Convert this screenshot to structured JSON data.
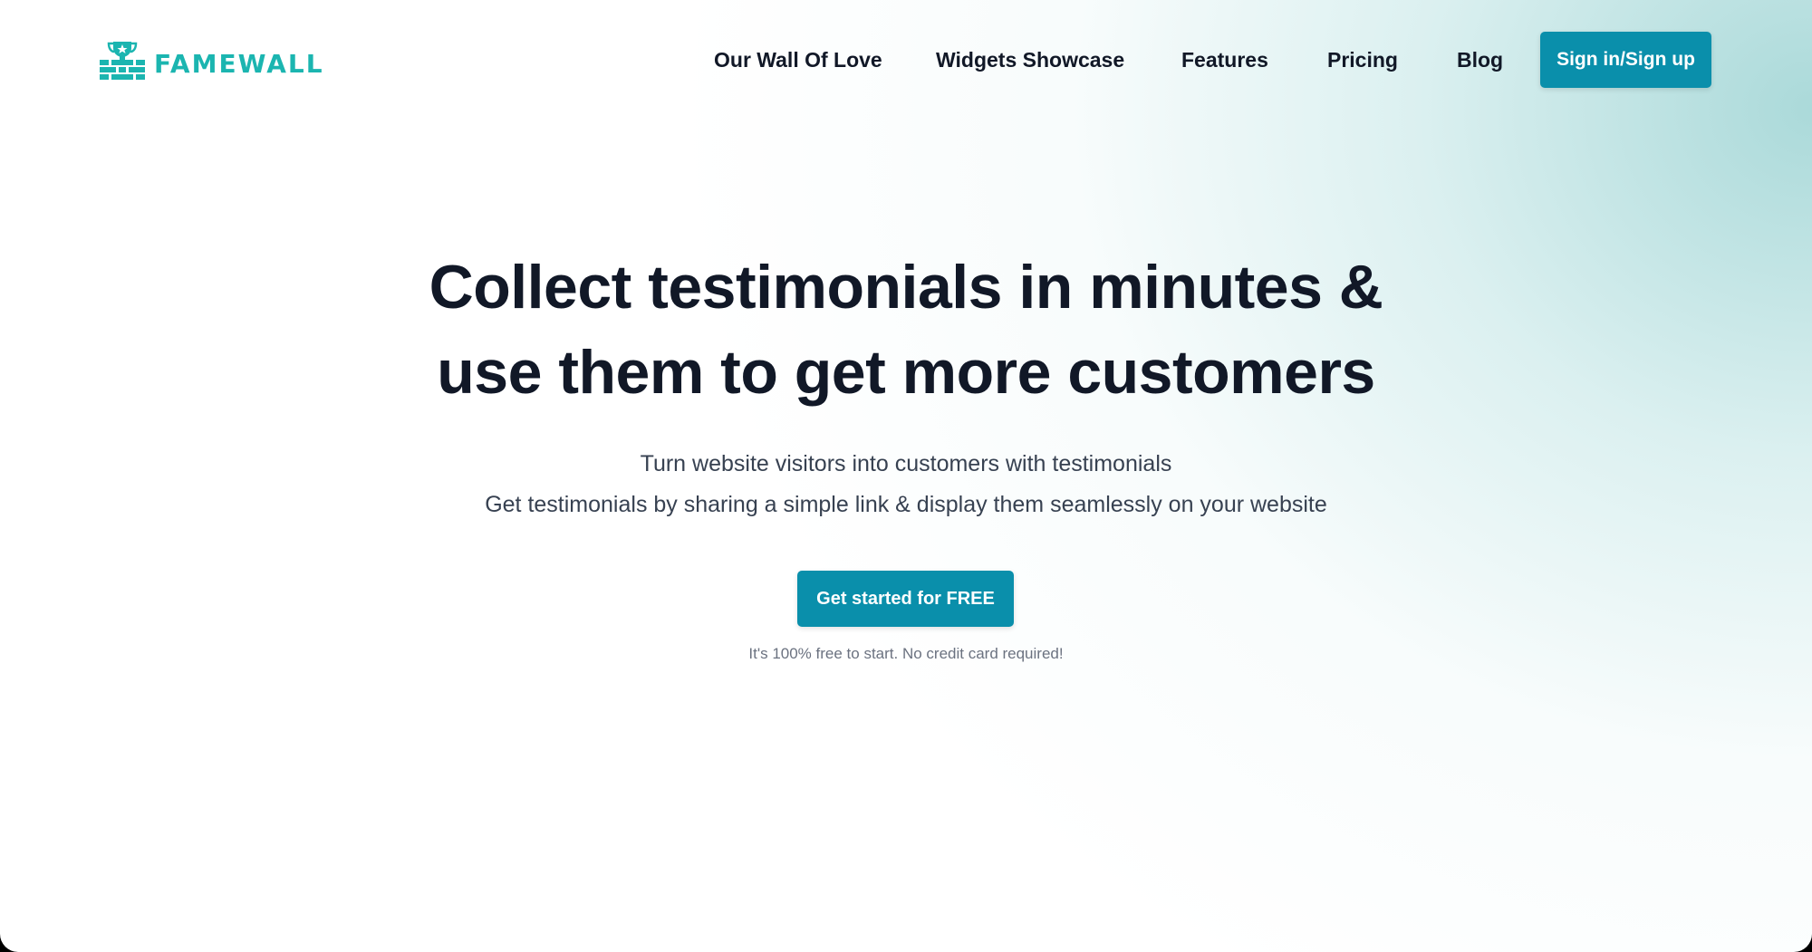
{
  "brand": {
    "name": "FAMEWALL",
    "color": "#1bb5b0",
    "logo_icon": "trophy-brick-wall-icon"
  },
  "nav": {
    "items": [
      {
        "label": "Our Wall Of Love"
      },
      {
        "label": "Widgets Showcase"
      },
      {
        "label": "Features"
      },
      {
        "label": "Pricing"
      },
      {
        "label": "Blog"
      }
    ],
    "signin_label": "Sign in/Sign up"
  },
  "hero": {
    "title_line1": "Collect testimonials in minutes &",
    "title_line2": "use them to get more customers",
    "subtitle_line1": "Turn website visitors into customers with testimonials",
    "subtitle_line2": "Get testimonials by sharing a simple link & display them seamlessly on your website",
    "cta_label": "Get started for FREE",
    "cta_note": "It's 100% free to start. No credit card required!"
  },
  "colors": {
    "primary_button": "#0a8fab",
    "heading_text": "#111827",
    "accent_glow": "#9cd3d3"
  }
}
